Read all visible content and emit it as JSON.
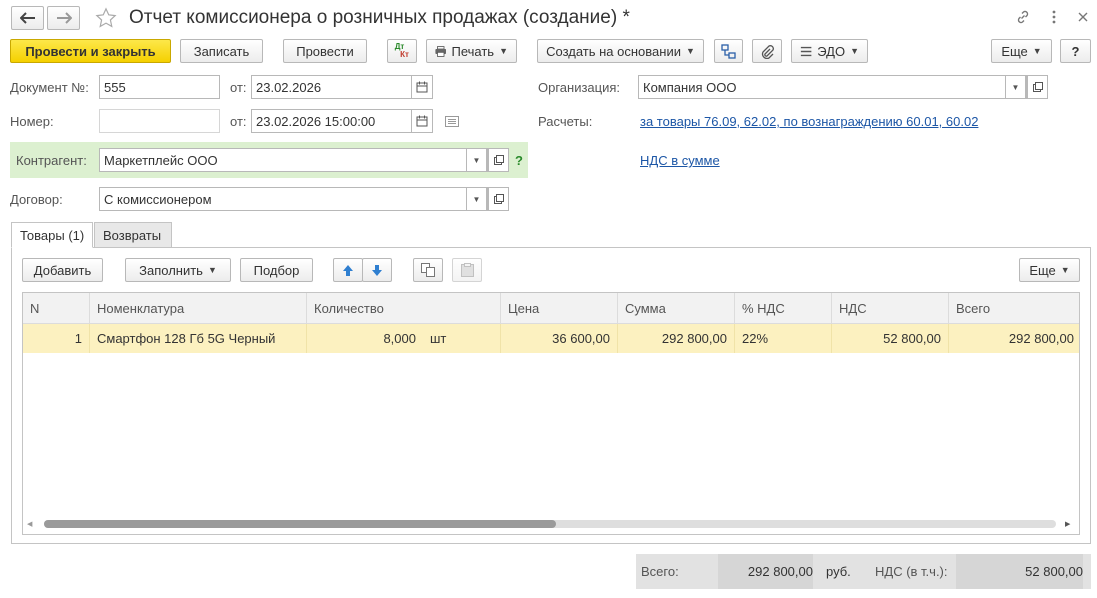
{
  "header": {
    "title": "Отчет комиссионера о розничных продажах (создание) *",
    "back_icon": "arrow-left-icon",
    "forward_icon": "arrow-right-icon",
    "favorite_icon": "star-icon",
    "link_icon": "link-icon",
    "menu_icon": "more-vertical-icon",
    "close_icon": "close-icon"
  },
  "toolbar": {
    "post_and_close": "Провести и закрыть",
    "save": "Записать",
    "post": "Провести",
    "dt_kt_top": "Дт",
    "dt_kt_bottom": "Кт",
    "print": "Печать",
    "create_based_on": "Создать на основании",
    "edo": "ЭДО",
    "more": "Еще",
    "help": "?"
  },
  "form": {
    "doc_number_label": "Документ №:",
    "doc_number_value": "555",
    "from_label_1": "от:",
    "date_value": "23.02.2026",
    "number_label": "Номер:",
    "number_value": "",
    "from_label_2": "от:",
    "datetime_value": "23.02.2026 15:00:00",
    "counterparty_label": "Контрагент:",
    "counterparty_value": "Маркетплейс ООО",
    "contract_label": "Договор:",
    "contract_value": "С комиссионером",
    "organization_label": "Организация:",
    "organization_value": "Компания ООО",
    "settlements_label": "Расчеты:",
    "settlements_link": "за товары 76.09, 62.02, по вознаграждению 60.01, 60.02",
    "vat_link": "НДС в сумме",
    "question_mark": "?"
  },
  "tabs": [
    {
      "label": "Товары (1)",
      "active": true
    },
    {
      "label": "Возвраты",
      "active": false
    }
  ],
  "table_toolbar": {
    "add": "Добавить",
    "fill": "Заполнить",
    "select": "Подбор",
    "more": "Еще"
  },
  "table": {
    "columns": [
      "N",
      "Номенклатура",
      "Количество",
      "Цена",
      "Сумма",
      "% НДС",
      "НДС",
      "Всего"
    ],
    "rows": [
      {
        "n": "1",
        "item": "Смартфон 128 Гб 5G Черный",
        "quantity": "8,000",
        "unit": "шт",
        "price": "36 600,00",
        "amount": "292 800,00",
        "vat_rate": "22%",
        "vat": "52 800,00",
        "total": "292 800,00"
      }
    ]
  },
  "totals": {
    "total_label": "Всего:",
    "total_value": "292 800,00",
    "currency": "руб.",
    "vat_label": "НДС (в т.ч.):",
    "vat_value": "52 800,00"
  },
  "colors": {
    "accent_yellow": "#f5d000",
    "selected_row": "#fcf1c0",
    "link": "#1c56a6",
    "counterparty_highlight": "#dcf0d0"
  }
}
